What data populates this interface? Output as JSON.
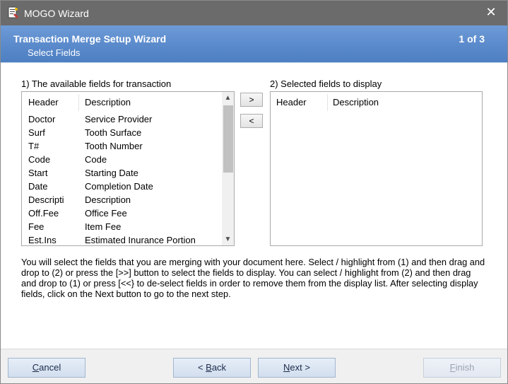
{
  "window": {
    "title": "MOGO Wizard",
    "close_glyph": "✕"
  },
  "banner": {
    "title": "Transaction Merge Setup Wizard",
    "subtitle": "Select Fields",
    "step": "1 of 3"
  },
  "available": {
    "label": "1) The available fields for transaction",
    "header_col": "Header",
    "description_col": "Description",
    "rows": [
      {
        "header": "Doctor",
        "description": "Service Provider"
      },
      {
        "header": "Surf",
        "description": "Tooth Surface"
      },
      {
        "header": "T#",
        "description": "Tooth Number"
      },
      {
        "header": "Code",
        "description": "Code"
      },
      {
        "header": "Start",
        "description": "Starting Date"
      },
      {
        "header": "Date",
        "description": "Completion Date"
      },
      {
        "header": "Descripti",
        "description": "Description"
      },
      {
        "header": "Off.Fee",
        "description": "Office Fee"
      },
      {
        "header": "Fee",
        "description": "Item Fee"
      },
      {
        "header": "Est.Ins",
        "description": "Estimated Inurance Portion"
      }
    ]
  },
  "selected": {
    "label": "2) Selected fields to display",
    "header_col": "Header",
    "description_col": "Description"
  },
  "move": {
    "add_label": ">",
    "remove_label": "<"
  },
  "help": {
    "text": "You will select the fields that you are merging with your document here.  Select / highlight from (1) and then drag and drop to (2) or press the [>>] button to select the fields to display.  You can select / highlight from (2) and then drag and drop to (1) or press [<<} to  de-select fields in order to remove them from the display list.  After selecting display fields, click on the Next button to go to the next step."
  },
  "footer": {
    "cancel_first": "C",
    "cancel_rest": "ancel",
    "back_prefix": "< ",
    "back_first": "B",
    "back_rest": "ack",
    "next_first": "N",
    "next_rest": "ext >",
    "finish_first": "F",
    "finish_rest": "inish"
  },
  "icons": {
    "app": "wizard-document-icon",
    "scroll_up": "▲",
    "scroll_down": "▼"
  },
  "colors": {
    "titlebar": "#6b6b6b",
    "banner": "#5a8acb",
    "button": "#d2deee"
  }
}
